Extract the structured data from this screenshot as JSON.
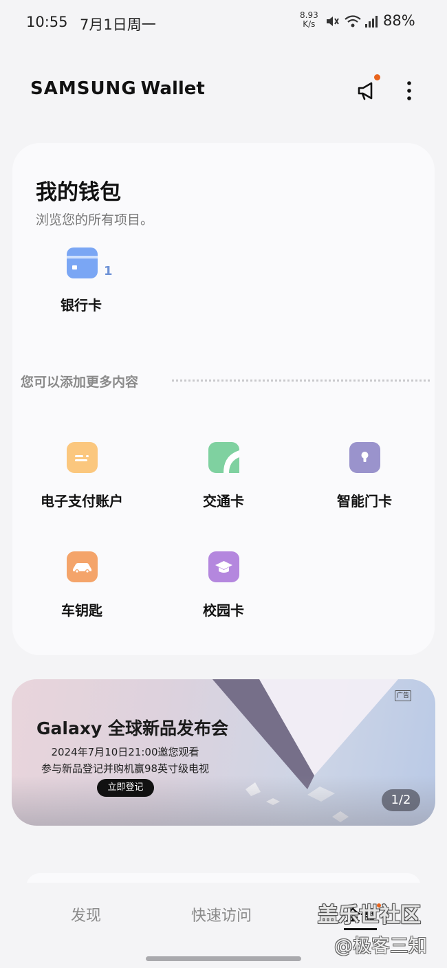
{
  "status_bar": {
    "time": "10:55",
    "date": "7月1日周一",
    "speed_value": "8.93",
    "speed_unit": "K/s",
    "battery": "88%"
  },
  "header": {
    "brand": "SAMSUNG",
    "product": "Wallet"
  },
  "wallet": {
    "title": "我的钱包",
    "subtitle": "浏览您的所有项目。",
    "bank_card": {
      "label": "银行卡",
      "count": "1"
    }
  },
  "add_more": {
    "title": "您可以添加更多内容",
    "items": [
      {
        "label": "电子支付账户",
        "icon": "payment-account-icon",
        "color": "#fbc77e"
      },
      {
        "label": "交通卡",
        "icon": "transit-card-icon",
        "color": "#7fd1a0"
      },
      {
        "label": "智能门卡",
        "icon": "smart-key-icon",
        "color": "#9a93cc"
      },
      {
        "label": "车钥匙",
        "icon": "car-key-icon",
        "color": "#f4a46a"
      },
      {
        "label": "校园卡",
        "icon": "campus-card-icon",
        "color": "#b487de"
      }
    ]
  },
  "banner": {
    "title": "Galaxy 全球新品发布会",
    "line1": "2024年7月10日21:00邀您观看",
    "line2": "参与新品登记并购机赢98英寸级电视",
    "cta": "立即登记",
    "ad_tag": "广告",
    "pager": "1/2"
  },
  "bottom_nav": {
    "tabs": [
      "发现",
      "快速访问",
      "全部"
    ]
  },
  "watermark": {
    "line1": "盖乐世社区",
    "line2": "@极客三知"
  }
}
